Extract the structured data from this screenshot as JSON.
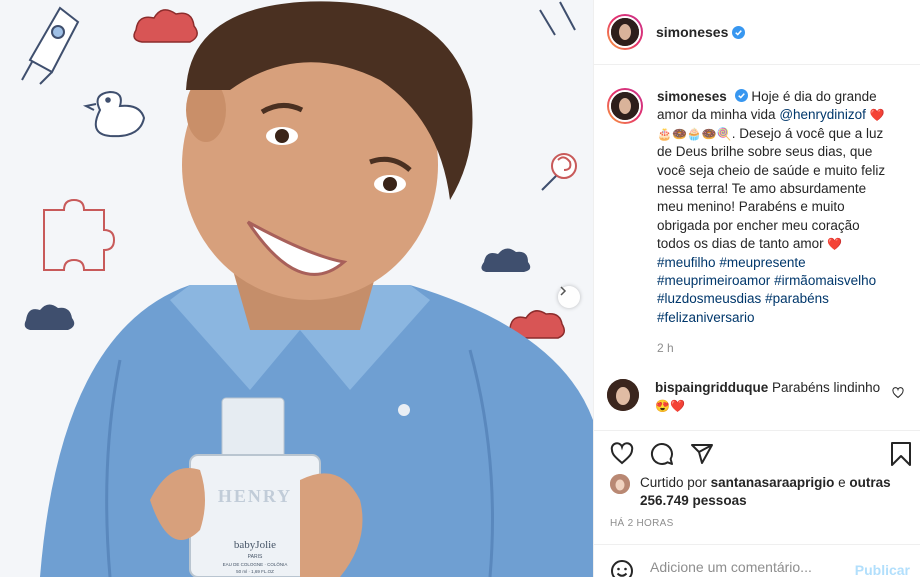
{
  "post": {
    "author": "simoneses",
    "caption_text": "Hoje é dia do grande amor da minha vida",
    "mention": "@henrydinizof",
    "emojis": "❤️🎂🍩🧁🍩🍭",
    "caption_text_2": ". Desejo á você que a luz de Deus brilhe sobre seus dias, que você seja cheio de saúde e muito feliz nessa terra! Te amo absurdamente meu menino! Parabéns e muito obrigada por encher meu coração todos os dias de tanto amor",
    "heart_emoji": "❤️",
    "hashtags": [
      "#meufilho",
      "#meupresente",
      "#meuprimeiroamor",
      "#irmãomaisvelho",
      "#luzdosmeusdias",
      "#parabéns",
      "#felizaniversario"
    ],
    "time_ago": "2 h",
    "date": "HÁ 2 HORAS",
    "photo_label": "HENRY",
    "bottle_brand": "babyJolie",
    "bottle_sub": "PARIS",
    "bottle_small": "EAU DE COLOGNE · COLÔNIA",
    "bottle_vol": "50 ml · 1,69 FL.OZ"
  },
  "comment": {
    "user": "bispaingridduque",
    "text": "Parabéns lindinho",
    "emoji": "😍❤️"
  },
  "likes": {
    "prefix": "Curtido por",
    "user": "santanasaraaprigio",
    "connector": "e",
    "others": "outras 256.749 pessoas"
  },
  "compose": {
    "placeholder": "Adicione um comentário...",
    "publish_label": "Publicar"
  },
  "colors": {
    "verified": "#3897f0",
    "link": "#00376b",
    "muted": "#8e8e8e",
    "publish": "#b2dffc"
  }
}
